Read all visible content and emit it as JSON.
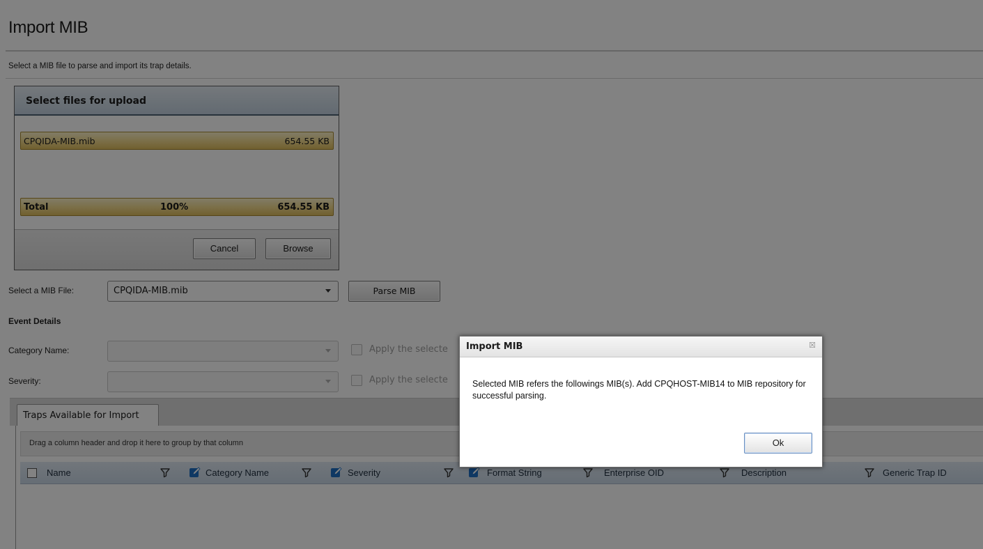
{
  "page": {
    "title": "Import MIB",
    "subtitle": "Select a MIB file to parse and import its trap details."
  },
  "upload": {
    "header": "Select files for upload",
    "file": {
      "name": "CPQIDA-MIB.mib",
      "size": "654.55 KB"
    },
    "total": {
      "label": "Total",
      "percent": "100%",
      "size": "654.55 KB"
    },
    "cancel_label": "Cancel",
    "browse_label": "Browse"
  },
  "mib_select": {
    "label": "Select a MIB File:",
    "value": "CPQIDA-MIB.mib",
    "parse_label": "Parse MIB"
  },
  "event_details": {
    "heading": "Event Details",
    "category_label": "Category Name:",
    "severity_label": "Severity:",
    "apply_category_text": "Apply the selecte",
    "apply_severity_text": "Apply the selecte"
  },
  "grid": {
    "tab_label": "Traps Available for Import",
    "group_hint": "Drag a column header and drop it here to group by that column",
    "columns": [
      {
        "label": "Name",
        "editable": false
      },
      {
        "label": "Category Name",
        "editable": true
      },
      {
        "label": "Severity",
        "editable": true
      },
      {
        "label": "Format String",
        "editable": true
      },
      {
        "label": "Enterprise OID",
        "editable": false
      },
      {
        "label": "Description",
        "editable": false
      },
      {
        "label": "Generic Trap ID",
        "editable": false
      }
    ]
  },
  "dialog": {
    "title": "Import MIB",
    "close_glyph": "☒",
    "message": "Selected MIB refers the followings MIB(s). Add CPQHOST-MIB14 to MIB repository for successful parsing.",
    "ok_label": "Ok"
  },
  "colors": {
    "overlay": "#000000",
    "progress_gold": "#f1d88a",
    "panel_header": "#c2d0de",
    "grid_header": "#c8d6e5",
    "edit_icon": "#1f6fc2"
  },
  "icons": {
    "filter": "funnel-icon",
    "edit": "edit-pencil-icon",
    "dropdown": "chevron-down-icon",
    "close": "close-icon"
  }
}
